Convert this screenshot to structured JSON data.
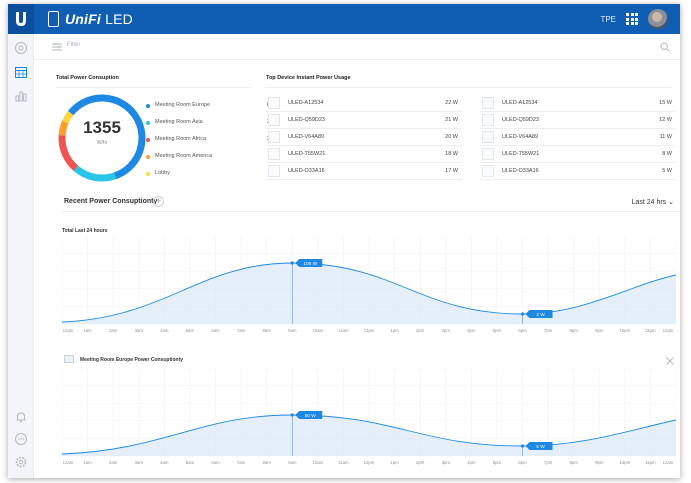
{
  "app": {
    "name_prefix": "UniFi",
    "name_suffix": " LED",
    "site_label": "TPE"
  },
  "filter": {
    "placeholder": "Filter"
  },
  "power_consumption": {
    "title": "Total Power Consuption",
    "total": "1355",
    "unit": "W/hr",
    "rooms": [
      {
        "label": "Meeting Room Europe",
        "value": "800",
        "color": "#1e88e5"
      },
      {
        "label": "Meeting Room Asia",
        "value": "225",
        "color": "#29c5e6"
      },
      {
        "label": "Meeting Room Africa",
        "value": "200",
        "color": "#ef5350"
      },
      {
        "label": "Meeting Room America",
        "value": "75",
        "color": "#ff9f2d"
      },
      {
        "label": "Lobby",
        "value": "55",
        "color": "#ffd740"
      }
    ]
  },
  "top_devices": {
    "title": "Top Device Instant Power Usage",
    "left": [
      {
        "name": "ULED-A12534",
        "power": "22 W"
      },
      {
        "name": "ULED-Q59D23",
        "power": "21 W"
      },
      {
        "name": "ULED-V64A89",
        "power": "20 W"
      },
      {
        "name": "ULED-T55W21",
        "power": "18 W"
      },
      {
        "name": "ULED-O33A16",
        "power": "17 W"
      }
    ],
    "right": [
      {
        "name": "ULED-A12534",
        "power": "15 W"
      },
      {
        "name": "ULED-Q59D23",
        "power": "12 W"
      },
      {
        "name": "ULED-V64A89",
        "power": "11 W"
      },
      {
        "name": "ULED-T55W21",
        "power": "8 W"
      },
      {
        "name": "ULED-O33A16",
        "power": "5 W"
      }
    ]
  },
  "recent": {
    "title": "Recent Power Consuptionty",
    "add_label": "+",
    "range": "Last 24 hrs ⌄"
  },
  "charts": [
    {
      "label": "Total Last 24 hours",
      "peak": {
        "text": "106 W",
        "hour": 9
      },
      "low": {
        "text": "2 W",
        "hour": 18
      },
      "closable": false
    },
    {
      "label": "Meeting Room Europe Power Consuptionty",
      "peak": {
        "text": "50 W",
        "hour": 9
      },
      "low": {
        "text": "5 W",
        "hour": 18
      },
      "closable": true
    }
  ],
  "x_ticks": [
    "12am",
    "1am",
    "2am",
    "3am",
    "4am",
    "5am",
    "6am",
    "7am",
    "8am",
    "9am",
    "10am",
    "11am",
    "12pm",
    "1pm",
    "2pm",
    "3pm",
    "4pm",
    "5pm",
    "6pm",
    "7pm",
    "8pm",
    "9pm",
    "10pm",
    "11pm",
    "12am"
  ],
  "colors": {
    "brand": "#0f5eb3",
    "accent": "#1e88e5",
    "area": "#d6e6f7"
  },
  "icons": [
    "unifi-logo-icon",
    "device-icon",
    "grid-apps-icon",
    "dashboard-icon",
    "calendar-icon",
    "stats-icon",
    "bell-icon",
    "chat-icon",
    "settings-icon",
    "filter-icon",
    "search-icon",
    "close-icon"
  ]
}
